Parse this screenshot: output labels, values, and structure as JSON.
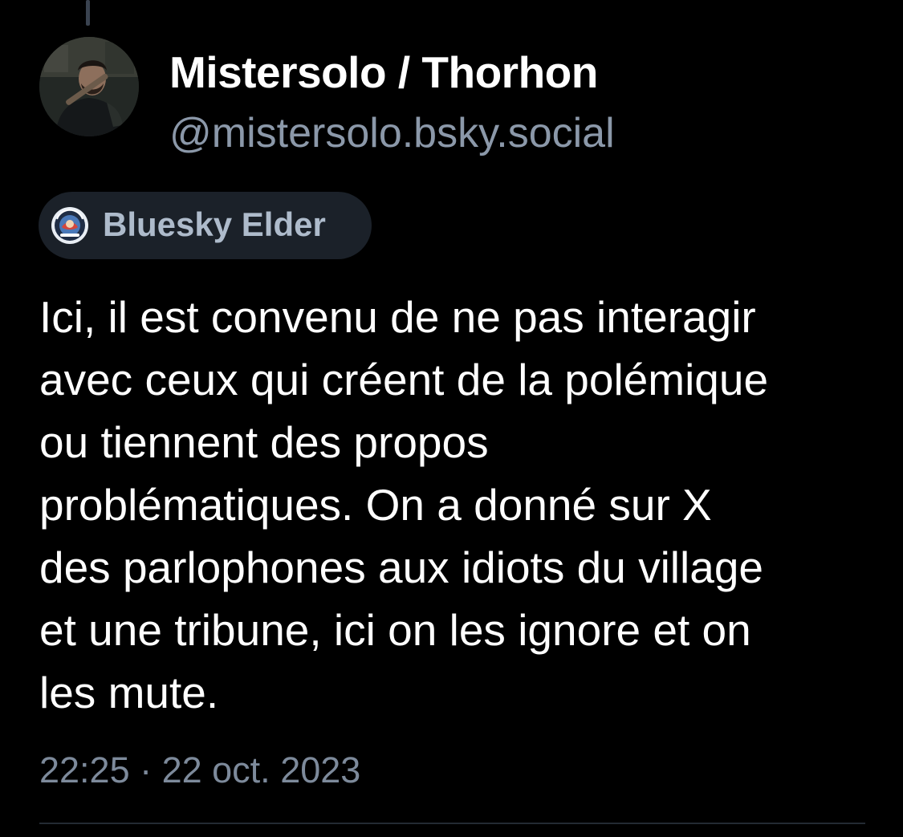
{
  "author": {
    "display_name": "Mistersolo / Thorhon",
    "handle": "@mistersolo.bsky.social"
  },
  "badge": {
    "label": "Bluesky Elder",
    "icon": "badge-emblem-icon"
  },
  "post": {
    "lines": [
      "Ici, il est convenu de ne pas interagir",
      "avec ceux qui créent de la polémique",
      "ou tiennent des propos",
      "problématiques. On a donné sur X",
      "des parlophones aux idiots du village",
      "et une tribune, ici on les ignore et on",
      "les mute."
    ],
    "timestamp": "22:25 · 22 oct. 2023"
  },
  "colors": {
    "background": "#000000",
    "text_primary": "#ffffff",
    "text_secondary": "#8b98a9",
    "badge_background": "#1b2129",
    "divider": "#232a33"
  }
}
